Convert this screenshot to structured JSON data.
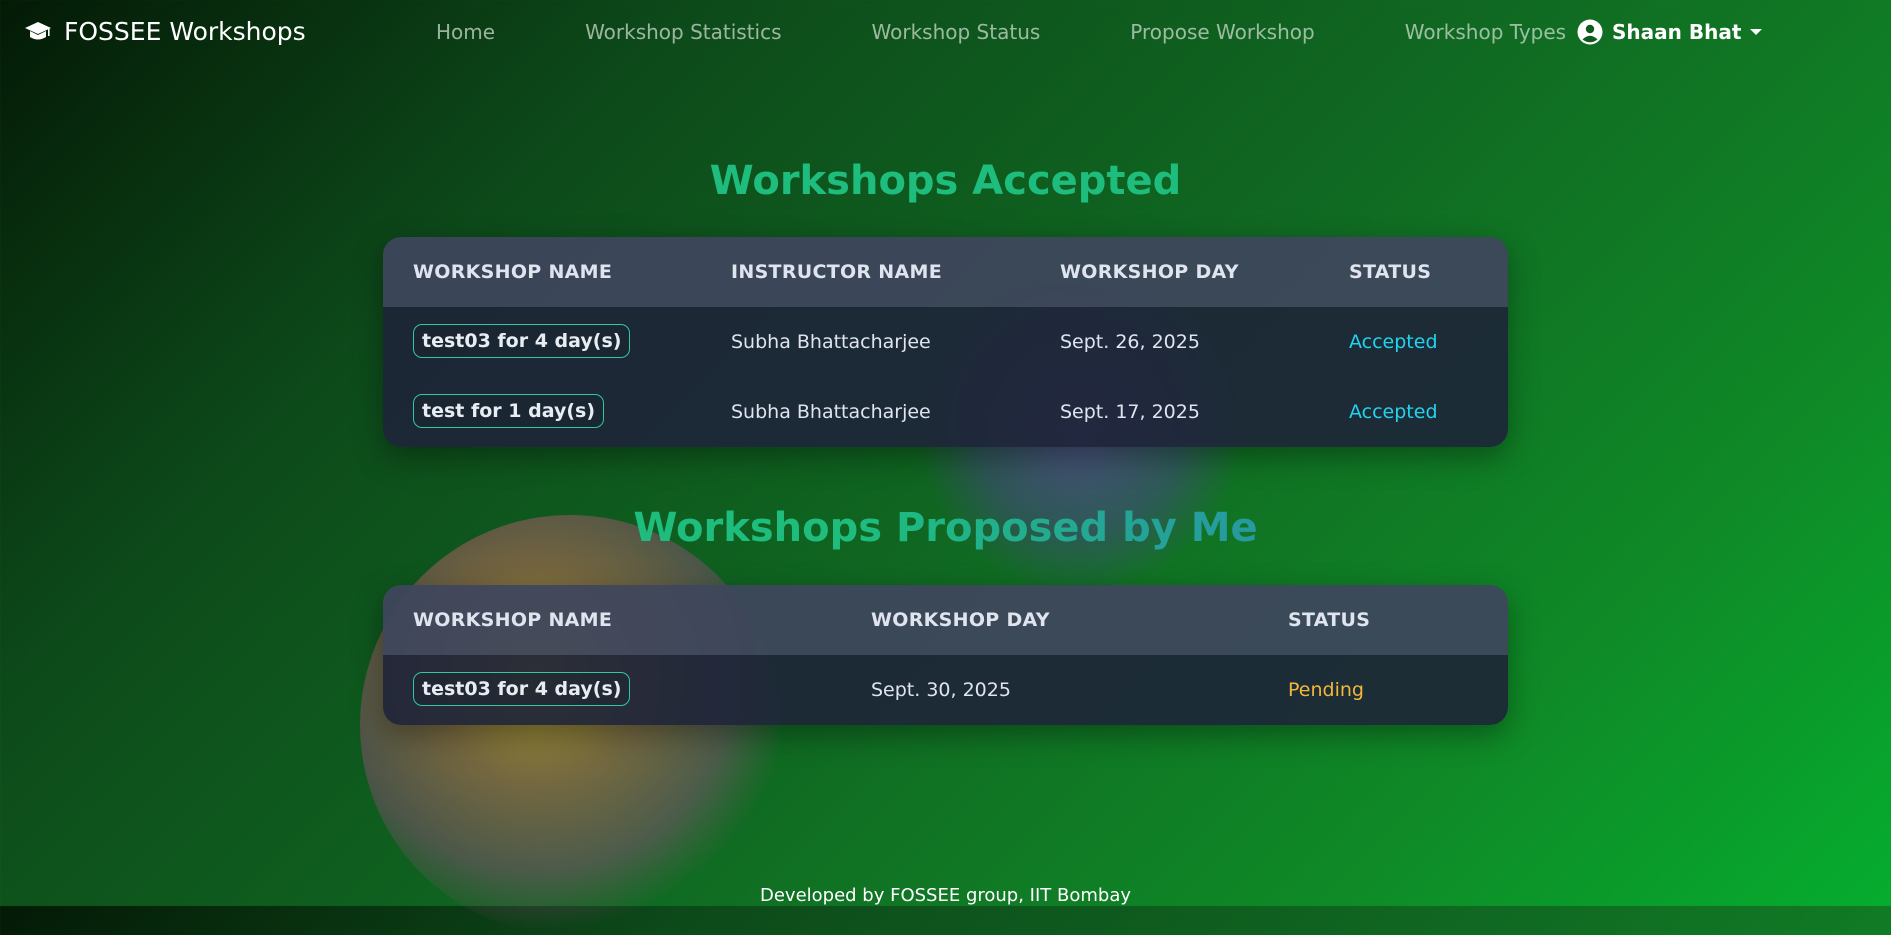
{
  "navbar": {
    "brand": "FOSSEE Workshops",
    "links": [
      "Home",
      "Workshop Statistics",
      "Workshop Status",
      "Propose Workshop",
      "Workshop Types"
    ],
    "user": "Shaan Bhat"
  },
  "accepted": {
    "title": "Workshops Accepted",
    "headers": [
      "WORKSHOP NAME",
      "INSTRUCTOR NAME",
      "WORKSHOP DAY",
      "STATUS"
    ],
    "rows": [
      {
        "name": "test03 for 4 day(s)",
        "instructor": "Subha Bhattacharjee",
        "day": "Sept. 26, 2025",
        "status": "Accepted"
      },
      {
        "name": "test for 1 day(s)",
        "instructor": "Subha Bhattacharjee",
        "day": "Sept. 17, 2025",
        "status": "Accepted"
      }
    ]
  },
  "proposed": {
    "title": "Workshops Proposed by Me",
    "headers": [
      "WORKSHOP NAME",
      "WORKSHOP DAY",
      "STATUS"
    ],
    "rows": [
      {
        "name": "test03 for 4 day(s)",
        "day": "Sept. 30, 2025",
        "status": "Pending"
      }
    ]
  },
  "footer": "Developed by FOSSEE group, IIT Bombay",
  "colors": {
    "heading_green": "#1ebd7e",
    "status_accepted": "#22d3ee",
    "status_pending": "#f4b73a",
    "pill_border": "#2ec9a0"
  },
  "icons": {
    "brand": "graduation-cap-icon",
    "user": "user-circle-icon",
    "dropdown": "caret-down-icon"
  }
}
